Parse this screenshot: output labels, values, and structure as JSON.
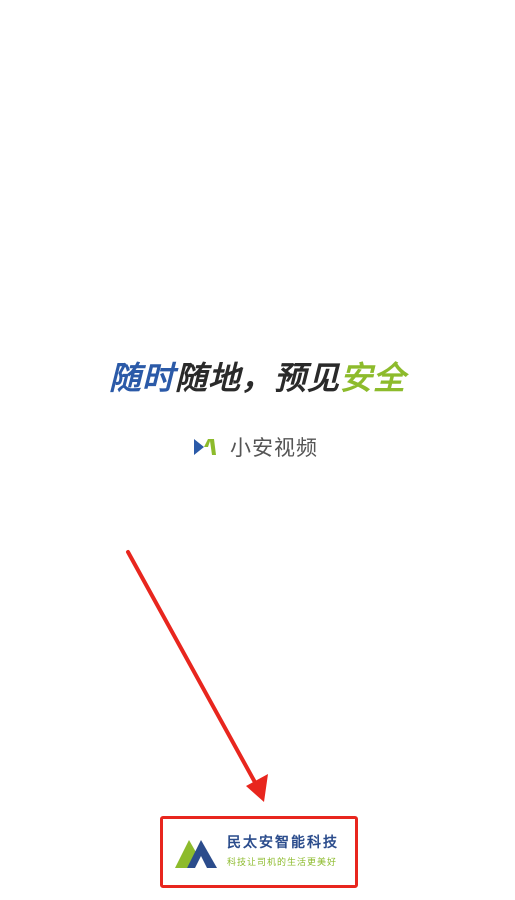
{
  "slogan": {
    "part1": "随时",
    "part2": "随地，预见",
    "part3": "安全"
  },
  "app": {
    "name": "小安视频",
    "logo_icon": "xiaoan-logo-icon"
  },
  "company": {
    "name": "民太安智能科技",
    "tagline": "科技让司机的生活更美好",
    "logo_icon": "mintaian-logo-icon"
  },
  "colors": {
    "blue": "#2b5aa8",
    "dark": "#2a2a2a",
    "green": "#8dbb2c",
    "annotation_red": "#e8261e"
  }
}
